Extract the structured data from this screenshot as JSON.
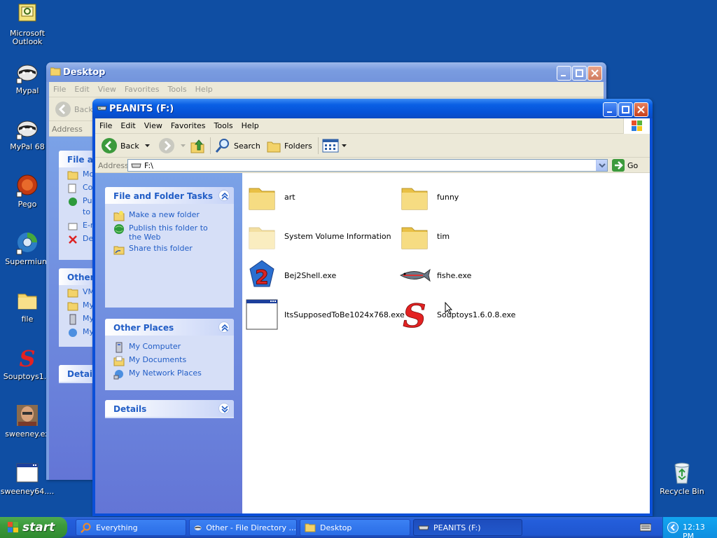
{
  "desktop_icons": [
    {
      "label": "Microsoft Outlook"
    },
    {
      "label": "Mypal"
    },
    {
      "label": "MyPal 68"
    },
    {
      "label": "Pego"
    },
    {
      "label": "Supermium"
    },
    {
      "label": "file"
    },
    {
      "label": "Souptoys1..."
    },
    {
      "label": "sweeney.ex"
    },
    {
      "label": "sweeney64...."
    },
    {
      "label": "Recycle Bin"
    }
  ],
  "back_window": {
    "title": "Desktop",
    "menu": [
      "File",
      "Edit",
      "View",
      "Favorites",
      "Tools",
      "Help"
    ],
    "back_label": "Back",
    "address_label": "Address",
    "panel1_title": "File an",
    "panel1_items": [
      "Mo",
      "Co",
      "Pul",
      "to",
      "E-m",
      "De"
    ],
    "panel2_title": "Other",
    "panel2_items": [
      "VM",
      "My",
      "My",
      "My"
    ],
    "panel3_title": "Details"
  },
  "front_window": {
    "title": "PEANITS (F:)",
    "menu": [
      "File",
      "Edit",
      "View",
      "Favorites",
      "Tools",
      "Help"
    ],
    "toolbar": {
      "back": "Back",
      "search": "Search",
      "folders": "Folders"
    },
    "address_label": "Address",
    "address_value": "F:\\",
    "go_label": "Go",
    "file_tasks": {
      "title": "File and Folder Tasks",
      "items": [
        "Make a new folder",
        "Publish this folder to the Web",
        "Share this folder"
      ]
    },
    "other_places": {
      "title": "Other Places",
      "items": [
        "My Computer",
        "My Documents",
        "My Network Places"
      ]
    },
    "details": {
      "title": "Details"
    },
    "files": [
      {
        "name": "art",
        "icon": "folder-icon"
      },
      {
        "name": "funny",
        "icon": "folder-icon"
      },
      {
        "name": "System Volume Information",
        "icon": "folder-hidden-icon"
      },
      {
        "name": "tim",
        "icon": "folder-icon"
      },
      {
        "name": "Bej2Shell.exe",
        "icon": "bejeweled-icon"
      },
      {
        "name": "fishe.exe",
        "icon": "fish-icon"
      },
      {
        "name": "ItsSupposedToBe1024x768.exe",
        "icon": "app-window-icon"
      },
      {
        "name": "Souptoys1.6.0.8.exe",
        "icon": "souptoys-icon"
      }
    ]
  },
  "taskbar": {
    "start_label": "start",
    "buttons": [
      "Everything",
      "Other - File Directory ...",
      "Desktop",
      "PEANITS (F:)"
    ],
    "clock": "12:13 PM"
  },
  "colors": {
    "desktop": "#0f4ea3",
    "title_active": "#0553d8",
    "link": "#215dc6",
    "start": "#3c9a3c"
  }
}
